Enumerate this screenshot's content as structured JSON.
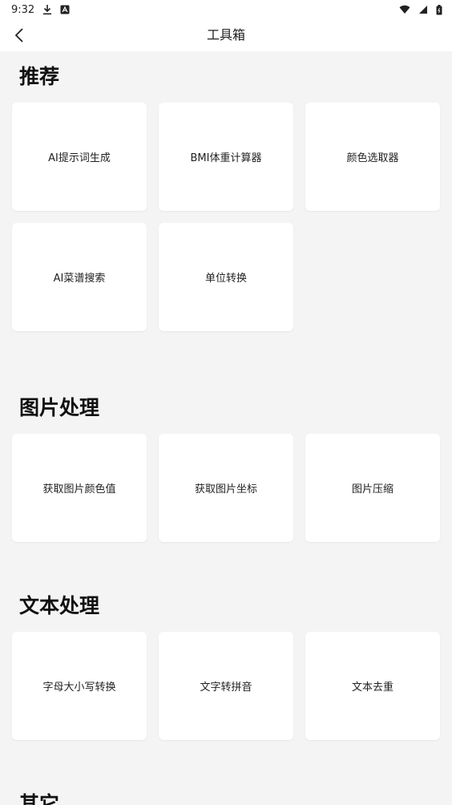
{
  "status": {
    "time": "9:32",
    "icons_left": [
      "download-icon",
      "notification-a-icon"
    ],
    "icons_right": [
      "wifi-icon",
      "signal-icon",
      "battery-icon"
    ]
  },
  "app_bar": {
    "title": "工具箱"
  },
  "sections": [
    {
      "title": "推荐",
      "tools": [
        "AI提示词生成",
        "BMI体重计算器",
        "颜色选取器",
        "AI菜谱搜索",
        "单位转换"
      ]
    },
    {
      "title": "图片处理",
      "tools": [
        "获取图片颜色值",
        "获取图片坐标",
        "图片压缩"
      ]
    },
    {
      "title": "文本处理",
      "tools": [
        "字母大小写转换",
        "文字转拼音",
        "文本去重"
      ]
    },
    {
      "title": "其它",
      "tools": []
    }
  ]
}
